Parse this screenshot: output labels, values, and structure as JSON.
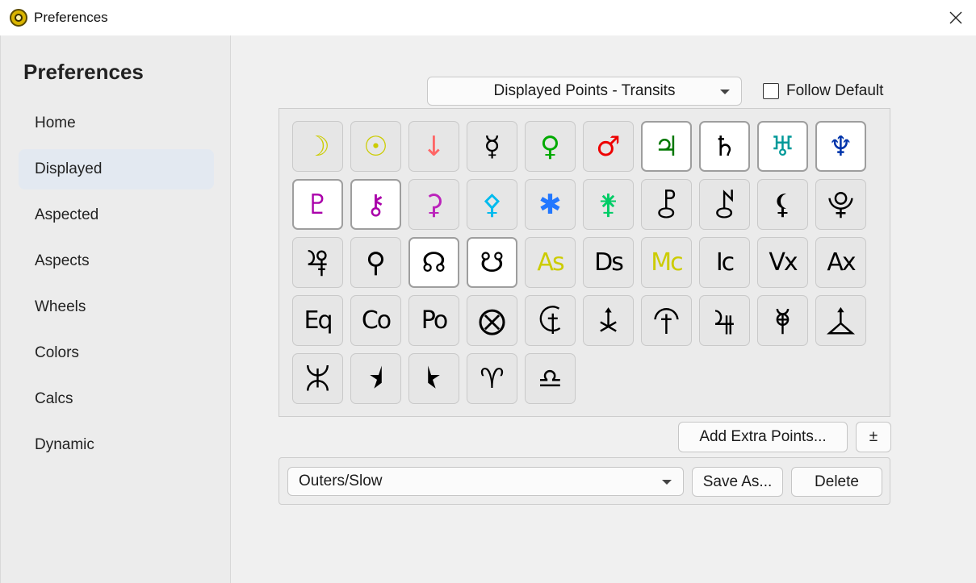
{
  "window": {
    "title": "Preferences"
  },
  "sidebar": {
    "title": "Preferences",
    "items": [
      {
        "label": "Home",
        "active": false
      },
      {
        "label": "Displayed",
        "active": true
      },
      {
        "label": "Aspected",
        "active": false
      },
      {
        "label": "Aspects",
        "active": false
      },
      {
        "label": "Wheels",
        "active": false
      },
      {
        "label": "Colors",
        "active": false
      },
      {
        "label": "Calcs",
        "active": false
      },
      {
        "label": "Dynamic",
        "active": false
      }
    ]
  },
  "displayed": {
    "set_select": "Displayed Points - Transits",
    "follow_default_label": "Follow Default",
    "follow_default_checked": false,
    "symbols": [
      {
        "name": "moon-icon",
        "glyph": "☽",
        "color": "#cccc00",
        "on": false
      },
      {
        "name": "sun-icon",
        "glyph": "☉",
        "color": "#cccc00",
        "on": false
      },
      {
        "name": "arrow-down-icon",
        "glyph": "↓",
        "color": "#ff6666",
        "on": false
      },
      {
        "name": "mercury-icon",
        "glyph": "☿",
        "color": "#000000",
        "on": false
      },
      {
        "name": "venus-icon",
        "glyph": "♀",
        "color": "#00aa00",
        "on": false
      },
      {
        "name": "mars-icon",
        "glyph": "♂",
        "color": "#ee0000",
        "on": false
      },
      {
        "name": "jupiter-icon",
        "glyph": "♃",
        "color": "#007700",
        "on": true
      },
      {
        "name": "saturn-icon",
        "glyph": "♄",
        "color": "#000000",
        "on": true
      },
      {
        "name": "uranus-icon",
        "glyph": "♅",
        "color": "#009999",
        "on": true
      },
      {
        "name": "neptune-icon",
        "glyph": "♆",
        "color": "#0033aa",
        "on": true
      },
      {
        "name": "pluto-icon",
        "glyph": "♇",
        "color": "#aa00aa",
        "on": true
      },
      {
        "name": "chiron-icon",
        "glyph": "⚷",
        "color": "#aa00aa",
        "on": true
      },
      {
        "name": "ceres-icon",
        "glyph": "⚳",
        "color": "#bb22bb",
        "on": false
      },
      {
        "name": "pallas-icon",
        "glyph": "⚴",
        "color": "#00bbee",
        "on": false
      },
      {
        "name": "juno-icon",
        "glyph": "✱",
        "color": "#2277ff",
        "on": false
      },
      {
        "name": "vesta-icon",
        "glyph": "⚵",
        "color": "#00cc66",
        "on": false
      },
      {
        "name": "pholus-icon",
        "glyph": "⯛",
        "color": "#000000",
        "on": false
      },
      {
        "name": "chariklo-icon",
        "glyph": "⯜",
        "color": "#000000",
        "on": false
      },
      {
        "name": "lilith-icon",
        "glyph": "⚸",
        "color": "#000000",
        "on": false
      },
      {
        "name": "true-lilith-icon",
        "glyph": "⯓",
        "color": "#000000",
        "on": false
      },
      {
        "name": "nessus-icon",
        "glyph": "⯠",
        "color": "#000000",
        "on": false
      },
      {
        "name": "part-fortune-icon",
        "glyph": "⚲",
        "color": "#000000",
        "on": false
      },
      {
        "name": "north-node-icon",
        "glyph": "☊",
        "color": "#000000",
        "on": true
      },
      {
        "name": "south-node-icon",
        "glyph": "☋",
        "color": "#000000",
        "on": true
      },
      {
        "name": "asc-icon",
        "glyph": "As",
        "color": "#cccc00",
        "on": false,
        "text": true
      },
      {
        "name": "desc-icon",
        "glyph": "Ds",
        "color": "#000000",
        "on": false,
        "text": true
      },
      {
        "name": "mc-icon",
        "glyph": "Mc",
        "color": "#cccc00",
        "on": false,
        "text": true
      },
      {
        "name": "ic-icon",
        "glyph": "Ic",
        "color": "#000000",
        "on": false,
        "text": true
      },
      {
        "name": "vertex-icon",
        "glyph": "Vx",
        "color": "#000000",
        "on": false,
        "text": true
      },
      {
        "name": "antivertex-icon",
        "glyph": "Ax",
        "color": "#000000",
        "on": false,
        "text": true
      },
      {
        "name": "equatorial-asc-icon",
        "glyph": "Eq",
        "color": "#000000",
        "on": false,
        "text": true
      },
      {
        "name": "co-asc-icon",
        "glyph": "Co",
        "color": "#000000",
        "on": false,
        "text": true
      },
      {
        "name": "polar-asc-icon",
        "glyph": "Po",
        "color": "#000000",
        "on": false,
        "text": true
      },
      {
        "name": "earth-icon",
        "glyph": "⨂",
        "color": "#000000",
        "on": false
      },
      {
        "name": "hades-icon",
        "glyph": "⯡",
        "color": "#000000",
        "on": false
      },
      {
        "name": "zeus-icon",
        "glyph": "⯢",
        "color": "#000000",
        "on": false
      },
      {
        "name": "kronos-icon",
        "glyph": "⯣",
        "color": "#000000",
        "on": false
      },
      {
        "name": "apollon-icon",
        "glyph": "⯤",
        "color": "#000000",
        "on": false
      },
      {
        "name": "admetos-icon",
        "glyph": "⯥",
        "color": "#000000",
        "on": false
      },
      {
        "name": "vulkanus-icon",
        "glyph": "⯦",
        "color": "#000000",
        "on": false
      },
      {
        "name": "poseidon-icon",
        "glyph": "⯧",
        "color": "#000000",
        "on": false
      },
      {
        "name": "transpluto-icon",
        "glyph": "⯨",
        "color": "#000000",
        "on": false
      },
      {
        "name": "vulcan-icon",
        "glyph": "⯩",
        "color": "#000000",
        "on": false
      },
      {
        "name": "aries-icon",
        "glyph": "♈",
        "color": "#000000",
        "on": false
      },
      {
        "name": "libra-icon",
        "glyph": "♎",
        "color": "#000000",
        "on": false
      }
    ],
    "add_extra_label": "Add Extra Points...",
    "plus_minus_label": "±"
  },
  "preset": {
    "value": "Outers/Slow",
    "save_as_label": "Save As...",
    "delete_label": "Delete"
  }
}
